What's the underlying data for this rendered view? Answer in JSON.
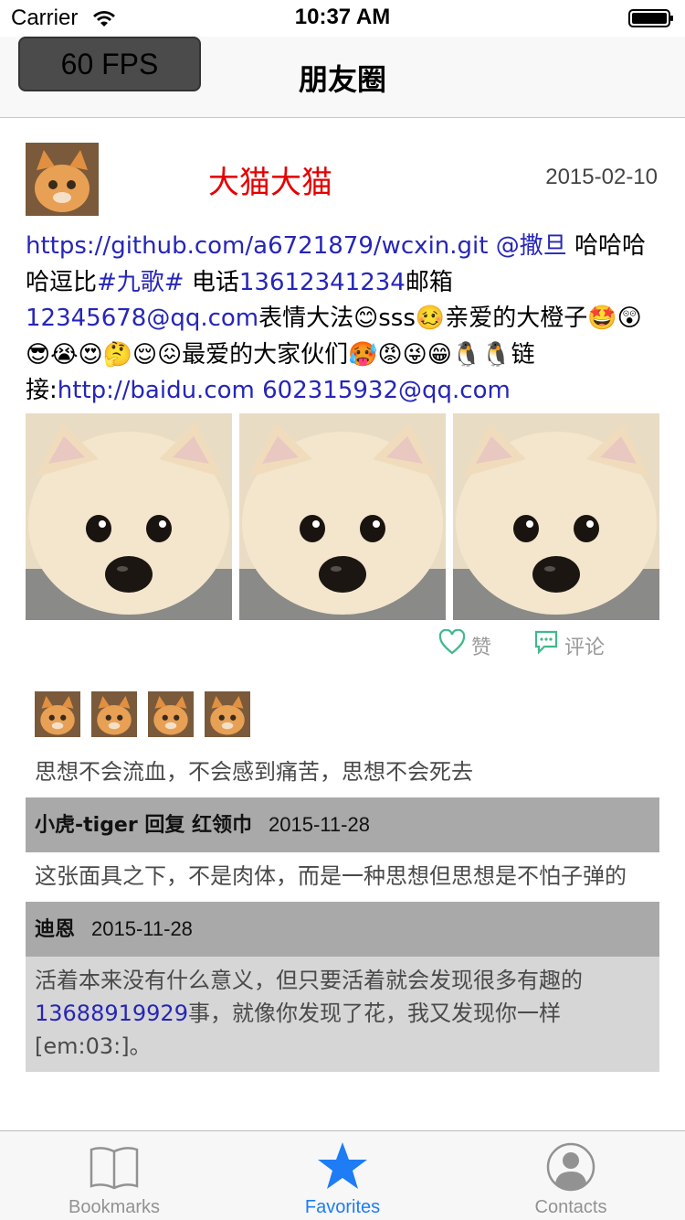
{
  "status_bar": {
    "carrier": "Carrier",
    "time": "10:37 AM"
  },
  "nav": {
    "fps": "60 FPS",
    "title": "朋友圈"
  },
  "post": {
    "author": "大猫大猫",
    "date": "2015-02-10",
    "text_segments": [
      {
        "text": "https://github.com/a6721879/wcxin.git @撒旦",
        "link": true
      },
      {
        "text": " 哈哈哈哈逗比",
        "link": false
      },
      {
        "text": "#九歌#",
        "link": true
      },
      {
        "text": " 电话",
        "link": false
      },
      {
        "text": "13612341234",
        "link": true
      },
      {
        "text": "邮箱",
        "link": false
      },
      {
        "text": "12345678@qq.com",
        "link": true
      },
      {
        "text": "表情大法😊sss🥴亲爱的大橙子🤩😲😎😭😍🤔😌😖最爱的大家伙们🥵😡😜😁🐧🐧链接:",
        "link": false
      },
      {
        "text": "http://baidu.com 602315932@qq.com",
        "link": true
      }
    ],
    "photos": [
      "pomeranian-photo",
      "pomeranian-photo",
      "pomeranian-photo"
    ],
    "like_label": "赞",
    "comment_label": "评论",
    "liker_count": 4
  },
  "comments": [
    {
      "type": "text",
      "shaded": false,
      "segments": [
        {
          "text": "思想不会流血，不会感到痛苦，思想不会死去",
          "link": false
        }
      ]
    },
    {
      "type": "head",
      "who": "小虎-tiger 回复 红领巾",
      "when": "2015-11-28"
    },
    {
      "type": "text",
      "shaded": false,
      "segments": [
        {
          "text": "这张面具之下，不是肉体，而是一种思想但思想是不怕子弹的",
          "link": false
        }
      ]
    },
    {
      "type": "head",
      "who": "迪恩",
      "when": "2015-11-28"
    },
    {
      "type": "text",
      "shaded": true,
      "segments": [
        {
          "text": "活着本来没有什么意义，但只要活着就会发现很多有趣的",
          "link": false
        },
        {
          "text": "13688919929",
          "link": true
        },
        {
          "text": "事，就像你发现了花，我又发现你一样[em:03:]。",
          "link": false
        }
      ]
    }
  ],
  "tabs": [
    {
      "label": "Bookmarks",
      "icon": "bookmarks-icon",
      "active": false
    },
    {
      "label": "Favorites",
      "icon": "favorites-star-icon",
      "active": true
    },
    {
      "label": "Contacts",
      "icon": "contacts-icon",
      "active": false
    }
  ],
  "colors": {
    "link": "#2626b8",
    "author": "#e60000",
    "tab_active": "#1e7cf5",
    "tab_inactive": "#929292",
    "comment_head_bg": "#a9a9a9",
    "comment_shaded_bg": "#d6d6d6"
  }
}
